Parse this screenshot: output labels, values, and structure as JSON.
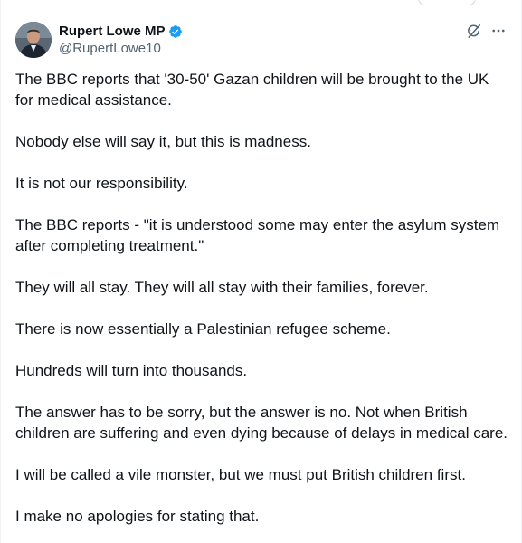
{
  "author": {
    "display_name": "Rupert Lowe MP",
    "handle": "@RupertLowe10",
    "verified_color": "#1d9bf0"
  },
  "icons": {
    "avatar": "profile-photo",
    "verified": "verified-badge-icon",
    "grok": "grok-icon",
    "more": "more-options-icon"
  },
  "tweet": {
    "paragraphs": [
      "The BBC reports that '30-50' Gazan children will be brought to the UK for medical assistance.",
      "Nobody else will say it, but this is madness.",
      "It is not our responsibility.",
      "The BBC reports - \"it is understood some may enter the asylum system after completing treatment.\"",
      "They will all stay. They will all stay with their families, forever.",
      "There is now essentially a Palestinian refugee scheme.",
      "Hundreds will turn into thousands.",
      "The answer has to be sorry, but the answer is no. Not when British children are suffering and even dying because of delays in medical care.",
      "I will be called a vile monster, but we must put British children first.",
      "I make no apologies for stating that."
    ]
  }
}
